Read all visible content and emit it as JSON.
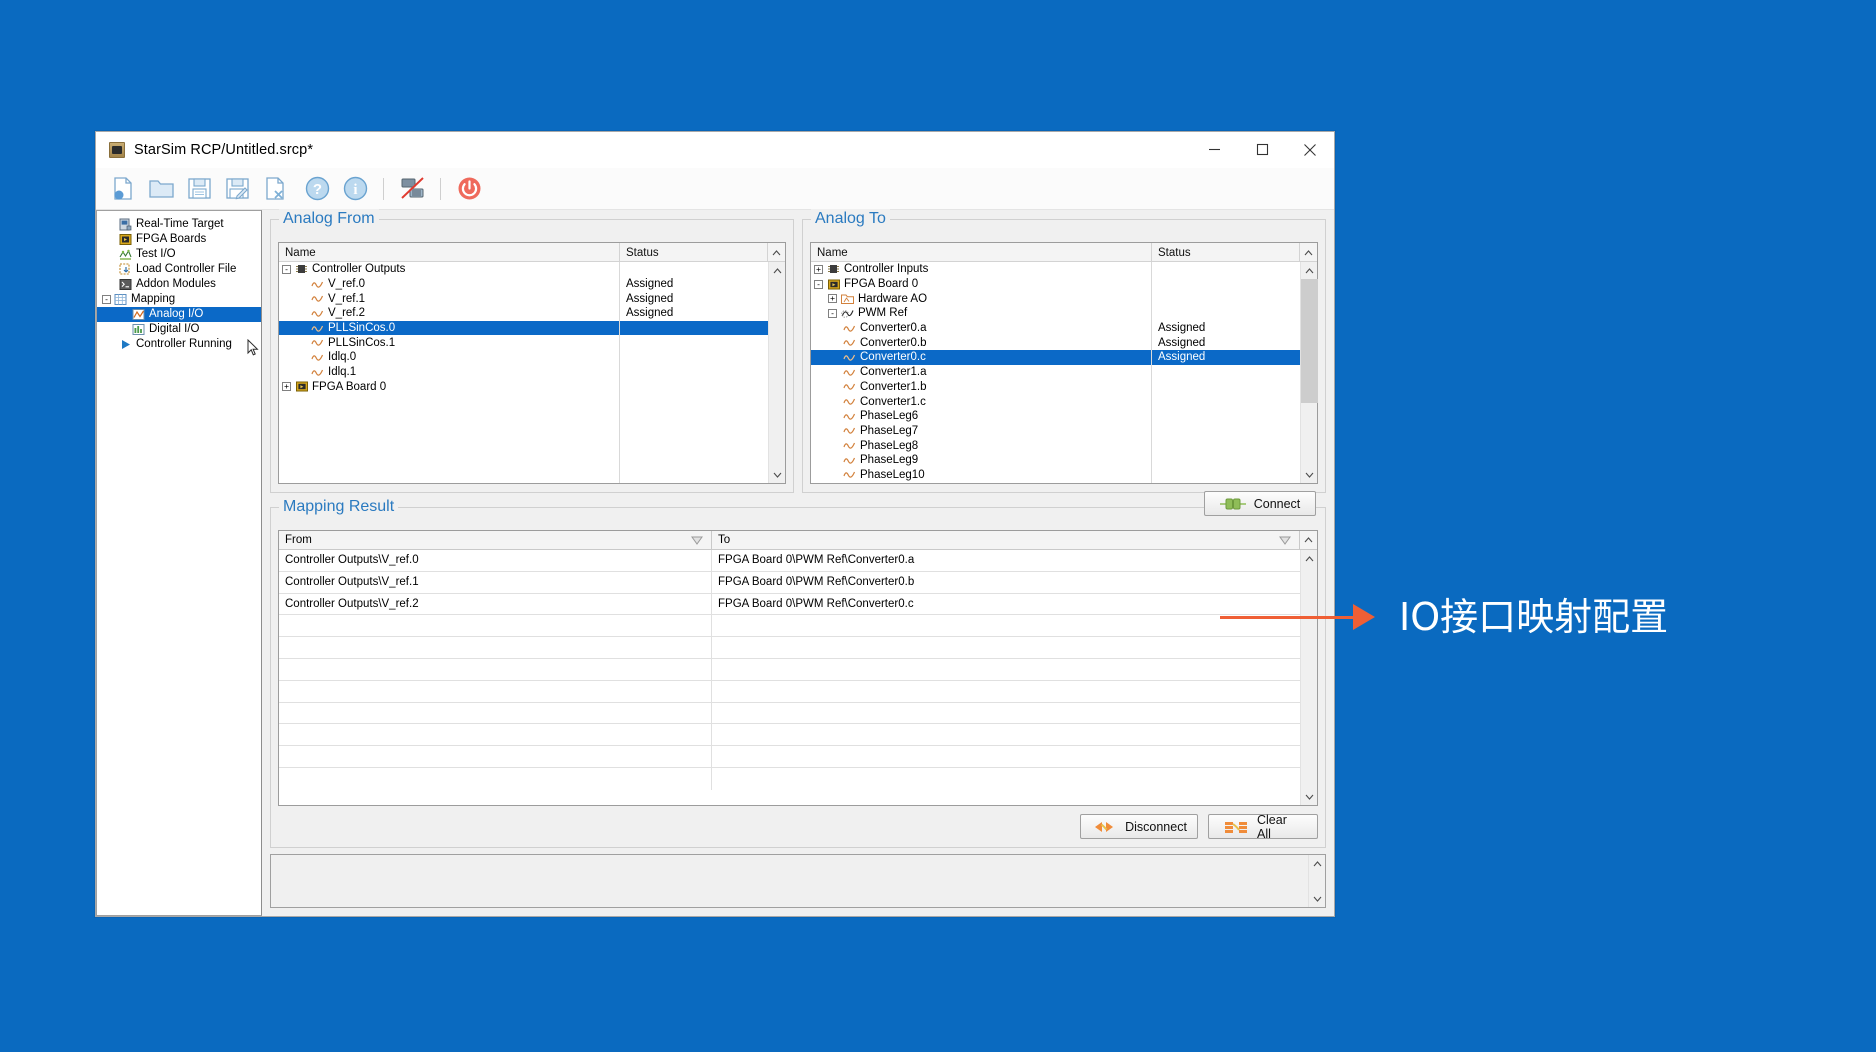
{
  "window": {
    "title": "StarSim RCP/Untitled.srcp*",
    "icon": "app-icon",
    "controls": {
      "minimize": "–",
      "maximize": "□",
      "close": "×"
    }
  },
  "toolbar": {
    "items": [
      {
        "name": "new-file-icon",
        "tip": "New"
      },
      {
        "name": "open-folder-icon",
        "tip": "Open"
      },
      {
        "name": "save-icon",
        "tip": "Save"
      },
      {
        "name": "save-as-icon",
        "tip": "Save As"
      },
      {
        "name": "close-file-icon",
        "tip": "Close"
      },
      {
        "name": "help-icon",
        "tip": "Help"
      },
      {
        "name": "info-icon",
        "tip": "About"
      },
      {
        "name": "disconnect-target-icon",
        "tip": "Disconnect Target"
      },
      {
        "name": "power-icon",
        "tip": "Power"
      }
    ]
  },
  "sidebar": {
    "items": [
      {
        "label": "Real-Time Target",
        "icon": "target-icon",
        "indent": 1,
        "expander": "",
        "selected": false
      },
      {
        "label": "FPGA Boards",
        "icon": "fpga-icon",
        "indent": 1,
        "expander": "",
        "selected": false
      },
      {
        "label": "Test I/O",
        "icon": "testio-icon",
        "indent": 1,
        "expander": "",
        "selected": false
      },
      {
        "label": "Load Controller File",
        "icon": "loadfile-icon",
        "indent": 1,
        "expander": "",
        "selected": false
      },
      {
        "label": "Addon Modules",
        "icon": "addon-icon",
        "indent": 1,
        "expander": "",
        "selected": false
      },
      {
        "label": "Mapping",
        "icon": "mapping-icon",
        "indent": 0,
        "expander": "-",
        "selected": false
      },
      {
        "label": "Analog I/O",
        "icon": "analog-icon",
        "indent": 2,
        "expander": "",
        "selected": true
      },
      {
        "label": "Digital I/O",
        "icon": "digital-icon",
        "indent": 2,
        "expander": "",
        "selected": false
      },
      {
        "label": "Controller Running",
        "icon": "play-icon",
        "indent": 1,
        "expander": "",
        "selected": false
      }
    ]
  },
  "analog_from": {
    "group_label": "Analog From",
    "columns": {
      "name": "Name",
      "status": "Status"
    },
    "rows": [
      {
        "label": "Controller Outputs",
        "status": "",
        "indent": 0,
        "expander": "-",
        "icon": "chip-icon",
        "selected": false
      },
      {
        "label": "V_ref.0",
        "status": "Assigned",
        "indent": 1,
        "expander": "",
        "icon": "sine-icon",
        "selected": false
      },
      {
        "label": "V_ref.1",
        "status": "Assigned",
        "indent": 1,
        "expander": "",
        "icon": "sine-icon",
        "selected": false
      },
      {
        "label": "V_ref.2",
        "status": "Assigned",
        "indent": 1,
        "expander": "",
        "icon": "sine-icon",
        "selected": false
      },
      {
        "label": "PLLSinCos.0",
        "status": "",
        "indent": 1,
        "expander": "",
        "icon": "sine-icon",
        "selected": true
      },
      {
        "label": "PLLSinCos.1",
        "status": "",
        "indent": 1,
        "expander": "",
        "icon": "sine-icon",
        "selected": false
      },
      {
        "label": "Idlq.0",
        "status": "",
        "indent": 1,
        "expander": "",
        "icon": "sine-icon",
        "selected": false
      },
      {
        "label": "Idlq.1",
        "status": "",
        "indent": 1,
        "expander": "",
        "icon": "sine-icon",
        "selected": false
      },
      {
        "label": "FPGA Board 0",
        "status": "",
        "indent": 0,
        "expander": "+",
        "icon": "fpga-icon",
        "selected": false
      }
    ]
  },
  "analog_to": {
    "group_label": "Analog To",
    "columns": {
      "name": "Name",
      "status": "Status"
    },
    "rows": [
      {
        "label": "Controller Inputs",
        "status": "",
        "indent": 0,
        "expander": "+",
        "icon": "chip-icon",
        "selected": false
      },
      {
        "label": "FPGA Board 0",
        "status": "",
        "indent": 0,
        "expander": "-",
        "icon": "fpga-icon",
        "selected": false
      },
      {
        "label": "Hardware AO",
        "status": "",
        "indent": 1,
        "expander": "+",
        "icon": "folder-ao-icon",
        "selected": false
      },
      {
        "label": "PWM Ref",
        "status": "",
        "indent": 1,
        "expander": "-",
        "icon": "pwm-icon",
        "selected": false
      },
      {
        "label": "Converter0.a",
        "status": "Assigned",
        "indent": 2,
        "expander": "",
        "icon": "sine-icon",
        "selected": false
      },
      {
        "label": "Converter0.b",
        "status": "Assigned",
        "indent": 2,
        "expander": "",
        "icon": "sine-icon",
        "selected": false
      },
      {
        "label": "Converter0.c",
        "status": "Assigned",
        "indent": 2,
        "expander": "",
        "icon": "sine-icon",
        "selected": true
      },
      {
        "label": "Converter1.a",
        "status": "",
        "indent": 2,
        "expander": "",
        "icon": "sine-icon",
        "selected": false
      },
      {
        "label": "Converter1.b",
        "status": "",
        "indent": 2,
        "expander": "",
        "icon": "sine-icon",
        "selected": false
      },
      {
        "label": "Converter1.c",
        "status": "",
        "indent": 2,
        "expander": "",
        "icon": "sine-icon",
        "selected": false
      },
      {
        "label": "PhaseLeg6",
        "status": "",
        "indent": 2,
        "expander": "",
        "icon": "sine-icon",
        "selected": false
      },
      {
        "label": "PhaseLeg7",
        "status": "",
        "indent": 2,
        "expander": "",
        "icon": "sine-icon",
        "selected": false
      },
      {
        "label": "PhaseLeg8",
        "status": "",
        "indent": 2,
        "expander": "",
        "icon": "sine-icon",
        "selected": false
      },
      {
        "label": "PhaseLeg9",
        "status": "",
        "indent": 2,
        "expander": "",
        "icon": "sine-icon",
        "selected": false
      },
      {
        "label": "PhaseLeg10",
        "status": "",
        "indent": 2,
        "expander": "",
        "icon": "sine-icon",
        "selected": false
      }
    ]
  },
  "mapping_result": {
    "group_label": "Mapping Result",
    "connect_label": "Connect",
    "disconnect_label": "Disconnect",
    "clear_all_label": "Clear All",
    "columns": {
      "from": "From",
      "to": "To"
    },
    "rows": [
      {
        "from": "Controller Outputs\\V_ref.0",
        "to": "FPGA Board 0\\PWM Ref\\Converter0.a"
      },
      {
        "from": "Controller Outputs\\V_ref.1",
        "to": "FPGA Board 0\\PWM Ref\\Converter0.b"
      },
      {
        "from": "Controller Outputs\\V_ref.2",
        "to": "FPGA Board 0\\PWM Ref\\Converter0.c"
      },
      {
        "from": "",
        "to": ""
      },
      {
        "from": "",
        "to": ""
      },
      {
        "from": "",
        "to": ""
      },
      {
        "from": "",
        "to": ""
      },
      {
        "from": "",
        "to": ""
      },
      {
        "from": "",
        "to": ""
      },
      {
        "from": "",
        "to": ""
      },
      {
        "from": "",
        "to": ""
      }
    ]
  },
  "log_pane": {
    "text": ""
  },
  "annotation": {
    "text": "IO接口映射配置",
    "color": "#ef5f35"
  },
  "colors": {
    "desktop": "#0a6ac0",
    "selection": "#0b69c7",
    "group_label": "#2a7ac0",
    "accent_orange": "#ef5f35",
    "window_bg": "#f0f0f0"
  }
}
